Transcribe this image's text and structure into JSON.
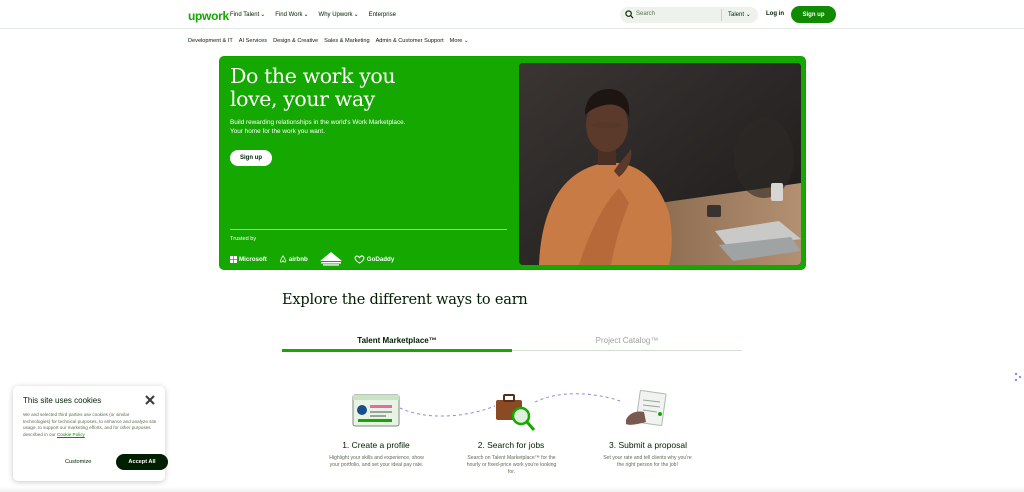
{
  "header": {
    "logo": "upwork",
    "nav": [
      "Find Talent",
      "Find Work",
      "Why Upwork",
      "Enterprise"
    ],
    "search_placeholder": "Search",
    "search_scope": "Talent",
    "login": "Log in",
    "signup": "Sign up"
  },
  "subnav": [
    "Development & IT",
    "AI Services",
    "Design & Creative",
    "Sales & Marketing",
    "Admin & Customer Support",
    "More"
  ],
  "hero": {
    "title": "Do the work you love, your way",
    "subtitle": "Build rewarding relationships in the world's Work Marketplace. Your home for the work you want.",
    "cta": "Sign up",
    "trusted_label": "Trusted by",
    "logos": [
      "Microsoft",
      "airbnb",
      "GoDaddy"
    ]
  },
  "explore": {
    "heading": "Explore the different ways to earn",
    "tabs": [
      "Talent Marketplace™",
      "Project Catalog™"
    ],
    "steps": [
      {
        "title": "1. Create a profile",
        "desc": "Highlight your skills and experience, show your portfolio, and set your ideal pay rate."
      },
      {
        "title": "2. Search for jobs",
        "desc": "Search on Talent Marketplace™ for the hourly or fixed-price work you're looking for."
      },
      {
        "title": "3. Submit a proposal",
        "desc": "Set your rate and tell clients why you're the right person for the job!"
      }
    ]
  },
  "cookie": {
    "title": "This site uses cookies",
    "text": "We and selected third parties use cookies (or similar technologies) for technical purposes, to enhance and analyze site usage, to support our marketing efforts, and for other purposes described in our",
    "link": "Cookie Policy",
    "customize": "Customize",
    "accept": "Accept All"
  },
  "colors": {
    "brand": "#14a800",
    "brand_dark": "#108a00",
    "text": "#001e00"
  },
  "icons": [
    "search-icon",
    "chevron-down-icon",
    "close-icon",
    "microsoft-logo",
    "airbnb-logo",
    "godaddy-logo"
  ]
}
